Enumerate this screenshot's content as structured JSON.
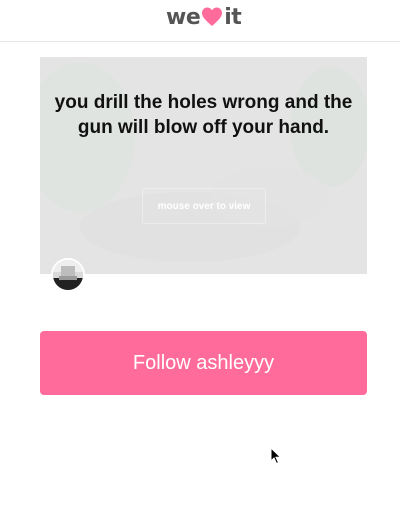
{
  "header": {
    "logo_left": "we",
    "logo_right": "it",
    "logo_icon": "heart-icon",
    "brand_color": "#ff6b9a"
  },
  "card": {
    "quote": "you drill the holes wrong and the gun will blow off your hand.",
    "mouse_over_label": "mouse over to view"
  },
  "follow": {
    "label": "Follow ashleyyy",
    "color": "#ff6b9a"
  },
  "cursor": {
    "icon": "arrow-cursor-icon"
  }
}
